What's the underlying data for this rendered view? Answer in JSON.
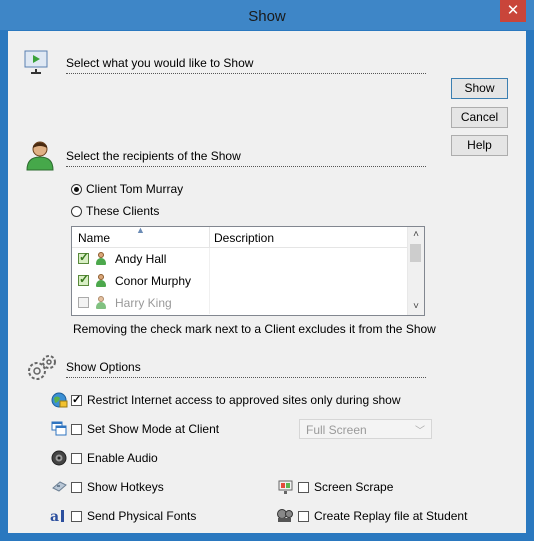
{
  "window": {
    "title": "Show",
    "close_glyph": "✕"
  },
  "sections": {
    "what": "Select what you would like to Show",
    "recipients": "Select the recipients of the Show",
    "options": "Show Options"
  },
  "buttons": {
    "show": "Show",
    "cancel": "Cancel",
    "help": "Help"
  },
  "recipients": {
    "radio_client": "Client Tom Murray",
    "radio_these": "These Clients",
    "selected": "client",
    "columns": [
      "Name",
      "Description"
    ],
    "clients": [
      {
        "name": "Andy Hall",
        "description": "",
        "checked": true
      },
      {
        "name": "Conor Murphy",
        "description": "",
        "checked": true
      },
      {
        "name": "Harry King",
        "description": "",
        "checked": false
      }
    ],
    "note": "Removing the check mark next to a Client excludes it from the Show"
  },
  "options": {
    "restrict_internet": {
      "label": "Restrict Internet access to approved sites only during show",
      "checked": true
    },
    "set_show_mode": {
      "label": "Set Show Mode at Client",
      "checked": false
    },
    "show_mode_value": "Full Screen",
    "enable_audio": {
      "label": "Enable Audio",
      "checked": false
    },
    "show_hotkeys": {
      "label": "Show Hotkeys",
      "checked": false
    },
    "send_physical_fonts": {
      "label": "Send Physical Fonts",
      "checked": false
    },
    "screen_scrape": {
      "label": "Screen Scrape",
      "checked": false
    },
    "create_replay": {
      "label": "Create Replay file at Student",
      "checked": false
    }
  }
}
